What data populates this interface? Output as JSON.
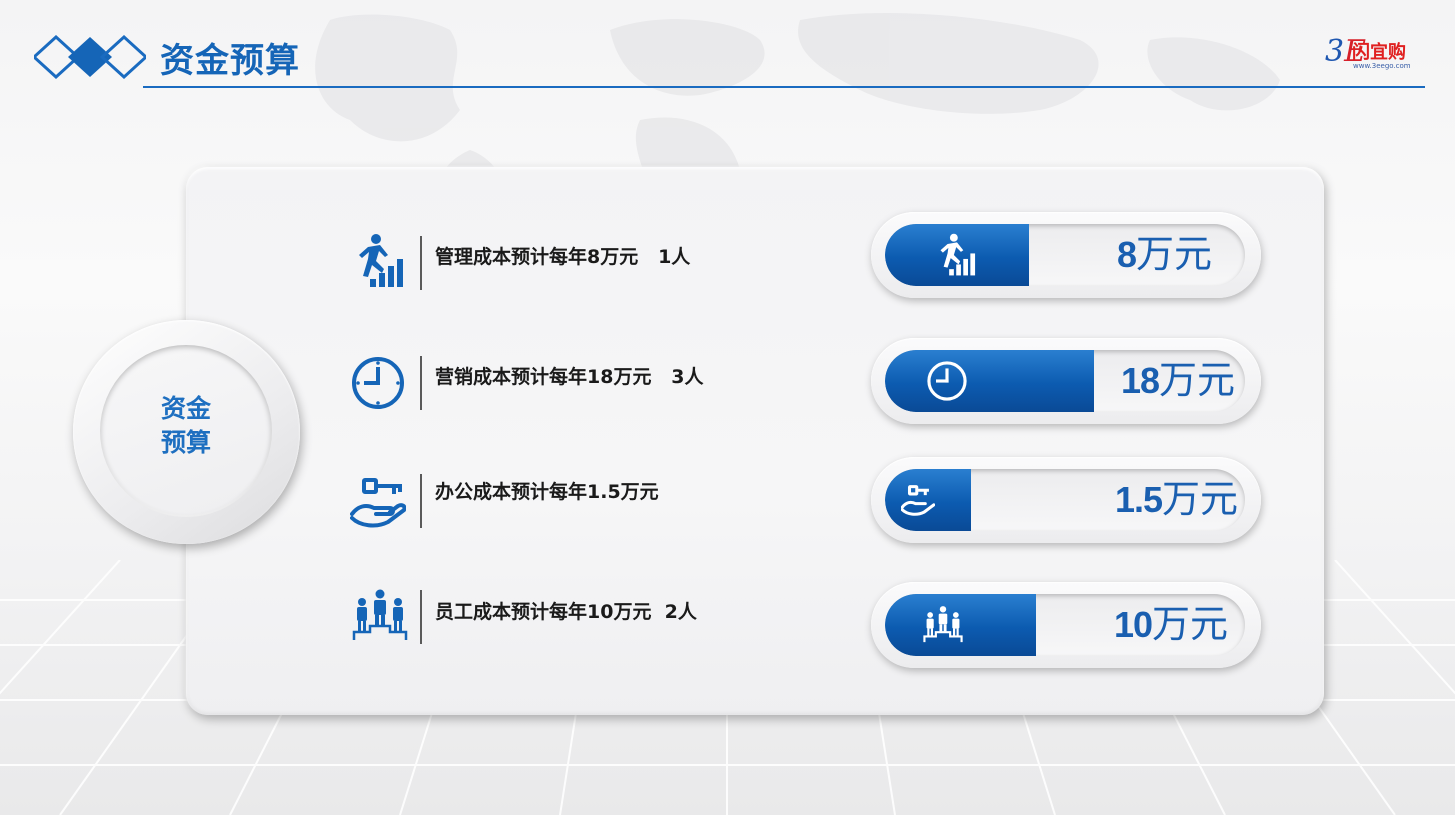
{
  "header": {
    "title": "资金预算",
    "brand": {
      "mark_3": "3",
      "mark_e": "E",
      "name": "闪宜购",
      "url": "www.3eego.com"
    }
  },
  "center": {
    "line1": "资金",
    "line2": "预算"
  },
  "colors": {
    "accent": "#1565b7",
    "bar": "#0c5bb0",
    "text": "#1a1a1a"
  },
  "rows": [
    {
      "icon": "climbing-stairs-icon",
      "label": "管理成本预计每年8万元   1人",
      "value": "8",
      "unit": "万元",
      "fill_fraction": 0.4
    },
    {
      "icon": "clock-icon",
      "label": "营销成本预计每年18万元   3人",
      "value": "18",
      "unit": "万元",
      "fill_fraction": 0.58
    },
    {
      "icon": "hand-key-icon",
      "label": "办公成本预计每年1.5万元",
      "value": "1.5",
      "unit": "万元",
      "fill_fraction": 0.24
    },
    {
      "icon": "team-podium-icon",
      "label": "员工成本预计每年10万元  2人",
      "value": "10",
      "unit": "万元",
      "fill_fraction": 0.42
    }
  ]
}
